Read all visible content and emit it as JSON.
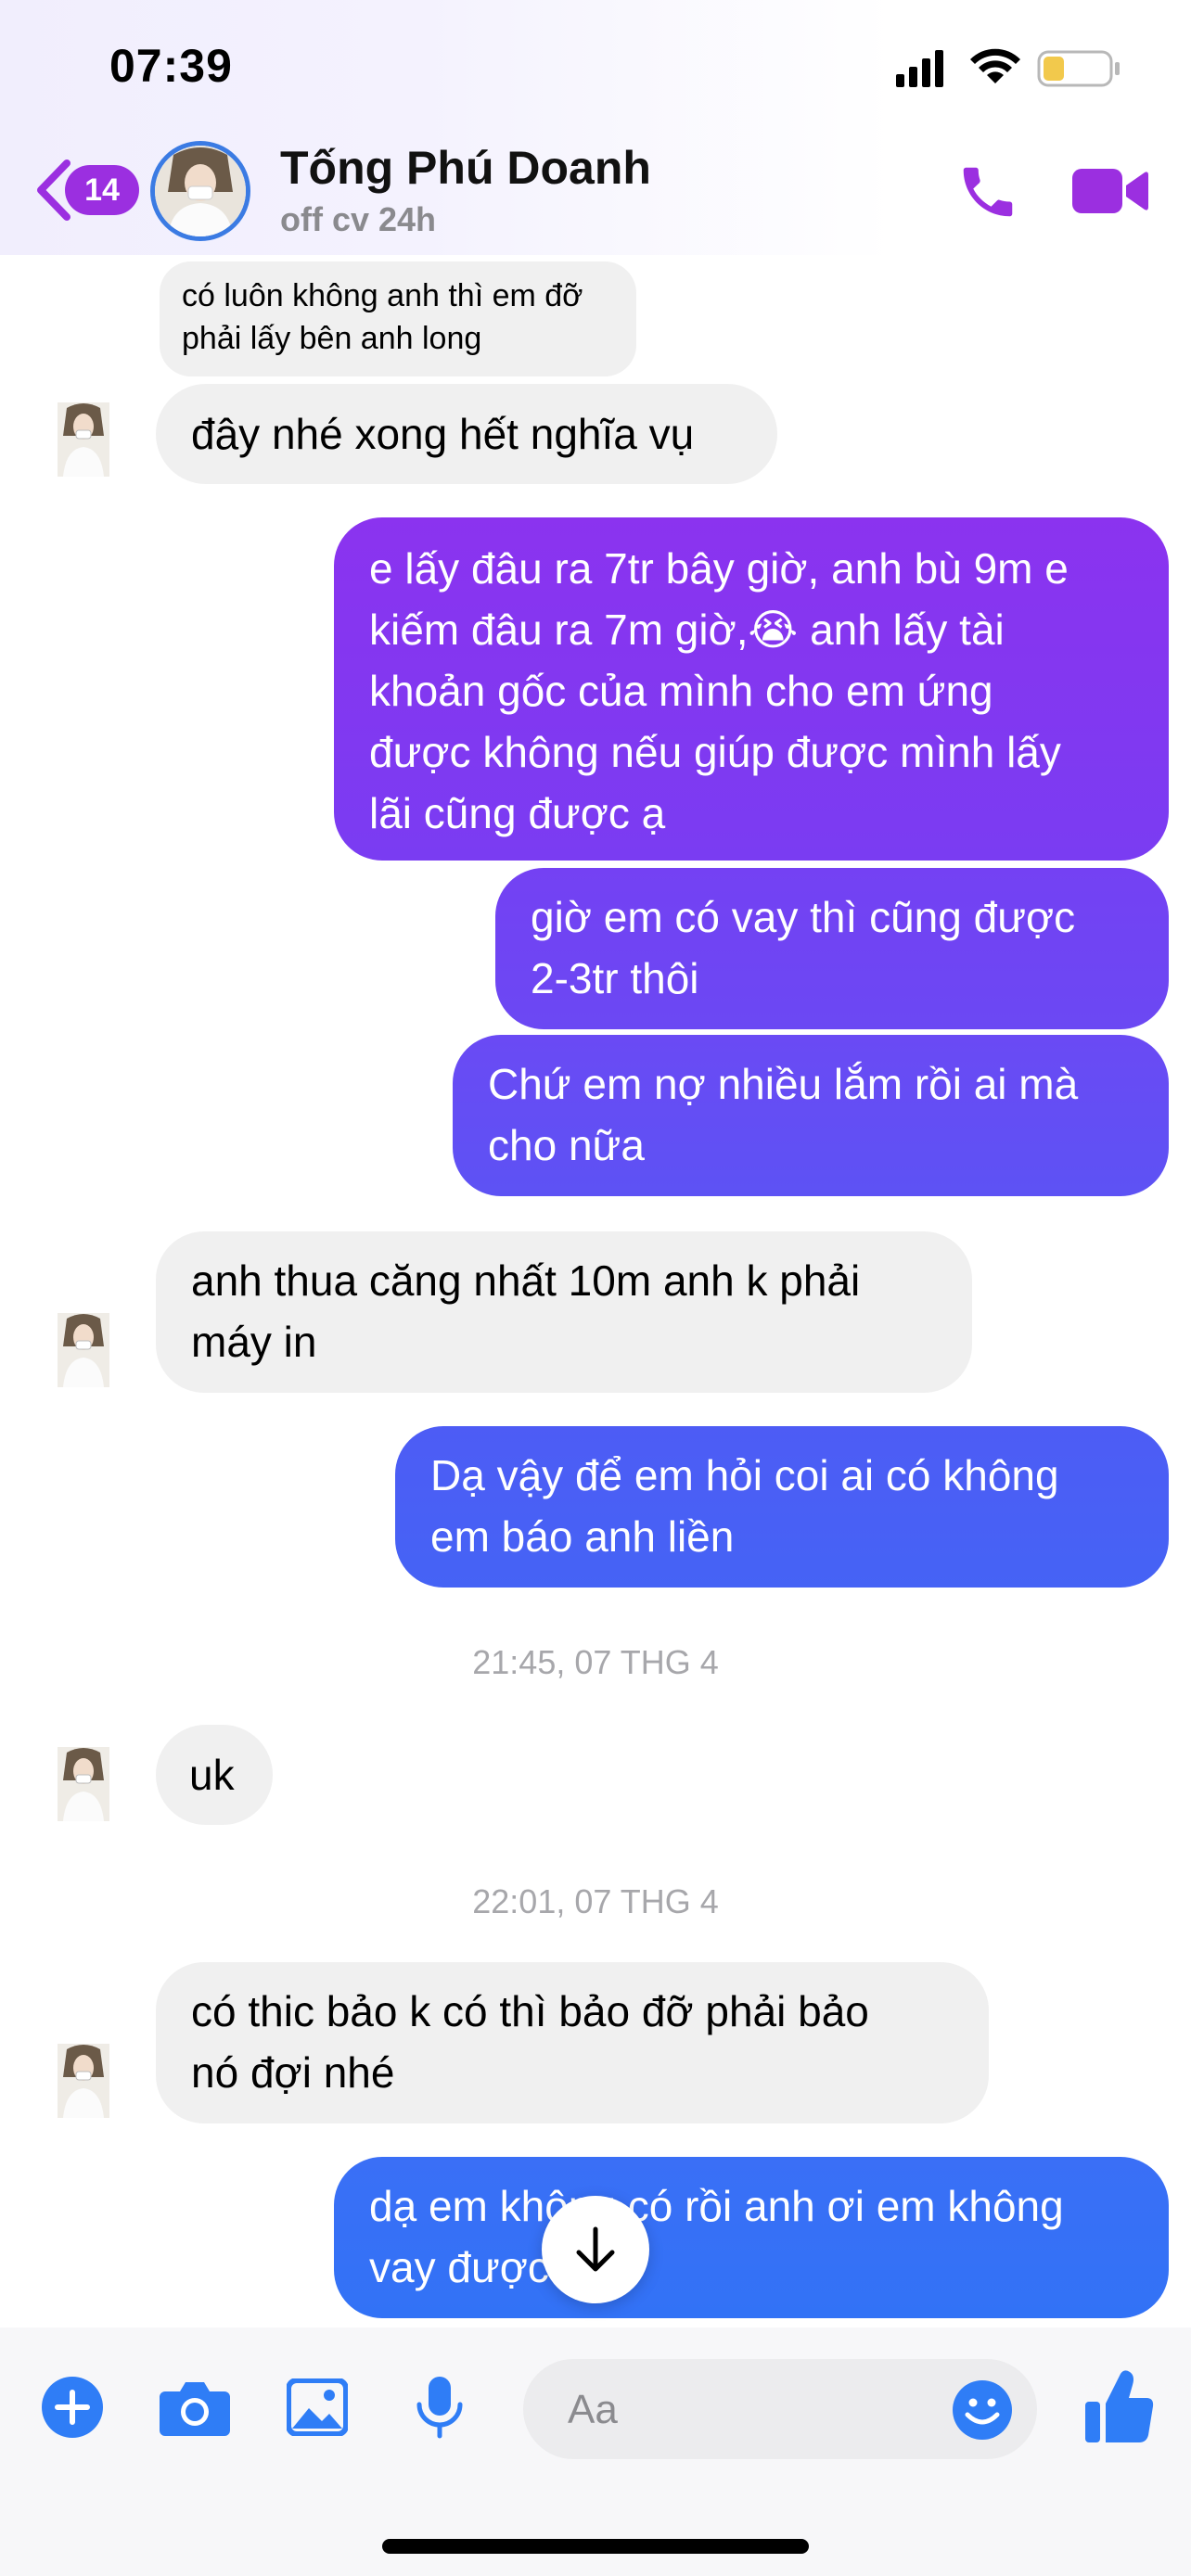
{
  "status_bar": {
    "time": "07:39"
  },
  "header": {
    "back_count": "14",
    "contact_name": "Tống Phú Doanh",
    "contact_status": "off cv 24h"
  },
  "messages": [
    {
      "text": "có luôn không anh thì em đỡ\nphải lấy bên anh long",
      "from": "contact"
    },
    {
      "text": "đây nhé xong hết nghĩa vụ",
      "from": "contact"
    },
    {
      "text": "e lấy đâu ra 7tr bây giờ, anh bù 9m e\nkiếm đâu ra 7m giờ,😭 anh lấy tài\nkhoản gốc của mình cho em ứng\nđược không nếu giúp được mình lấy\nlãi cũng được ạ",
      "from": "me"
    },
    {
      "text": "giờ em có vay thì cũng được\n2-3tr thôi",
      "from": "me"
    },
    {
      "text": "Chứ em nợ nhiều lắm rồi ai mà\ncho nữa",
      "from": "me"
    },
    {
      "text": "anh thua căng nhất 10m anh k phải\nmáy in",
      "from": "contact"
    },
    {
      "text": "Dạ vậy để em hỏi coi ai có không\nem báo anh liền",
      "from": "me"
    },
    {
      "text": "uk",
      "from": "contact"
    },
    {
      "text": "có thic bảo k có thì bảo đỡ phải bảo\nnó đợi nhé",
      "from": "contact"
    },
    {
      "text": "dạ em không có rồi anh ơi em không\nvay được ạ😞",
      "from": "me"
    }
  ],
  "timestamps": [
    "21:45, 07 THG 4",
    "22:01, 07 THG 4"
  ],
  "composer": {
    "placeholder": "Aa"
  },
  "colors": {
    "accent": "#9b2fe0",
    "outgoing_top": "#8a36f0",
    "outgoing_bottom": "#2f6df6",
    "incoming": "#f0f0f0",
    "composer_icon": "#2f7df6"
  }
}
